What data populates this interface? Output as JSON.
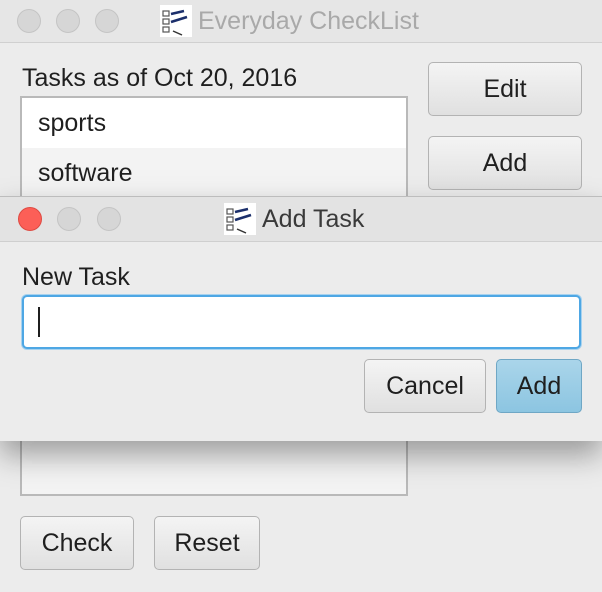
{
  "main_window": {
    "title": "Everyday CheckList",
    "icon": "checklist-app-icon",
    "tasks_label": "Tasks as of Oct 20, 2016",
    "tasks": [
      {
        "label": "sports"
      },
      {
        "label": "software"
      }
    ],
    "buttons": {
      "edit": "Edit",
      "add": "Add",
      "check": "Check",
      "reset": "Reset"
    }
  },
  "dialog": {
    "title": "Add Task",
    "icon": "checklist-app-icon",
    "field_label": "New Task",
    "field_value": "",
    "buttons": {
      "cancel": "Cancel",
      "add": "Add"
    }
  },
  "colors": {
    "window_background": "#ececec",
    "close_button_active": "#fc5f57",
    "primary_button": "#9ccde5",
    "focus_ring": "#4ea7e4"
  }
}
